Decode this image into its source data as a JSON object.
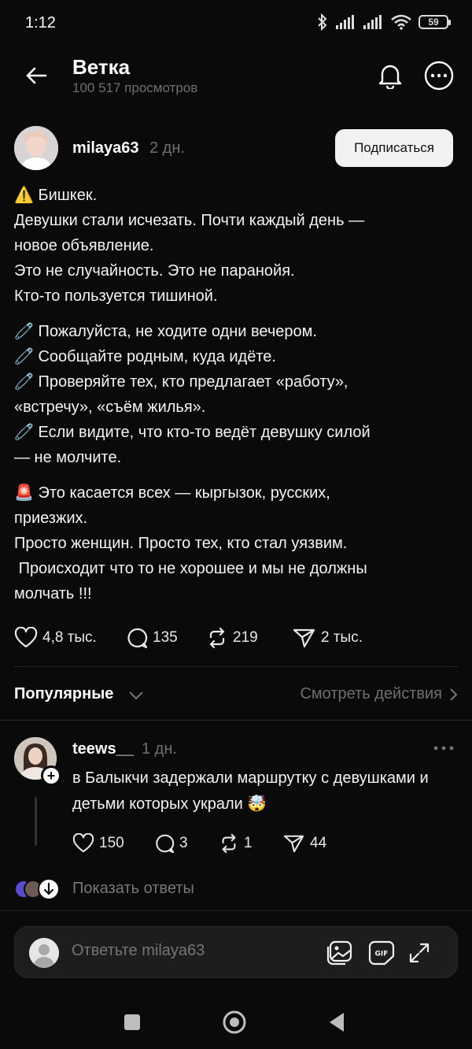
{
  "status_bar": {
    "time": "1:12",
    "battery": "59"
  },
  "header": {
    "title": "Ветка",
    "views": "100 517 просмотров"
  },
  "post": {
    "username": "milaya63",
    "time": "2 дн.",
    "subscribe_label": "Подписаться",
    "paragraphs": [
      [
        "⚠️ Бишкек.",
        "Девушки стали исчезать. Почти каждый день —",
        "новое объявление.",
        "Это не случайность. Это не паранойя.",
        "Кто-то пользуется тишиной."
      ],
      [
        "🧷 Пожалуйста, не ходите одни вечером.",
        "🧷 Сообщайте родным, куда идёте.",
        "🧷 Проверяйте тех, кто предлагает «работу»,",
        "«встречу», «съём жилья».",
        "🧷 Если видите, что кто-то ведёт девушку силой",
        "— не молчите."
      ],
      [
        "🚨 Это касается всех — кыргызок, русских,",
        "приезжих.",
        "Просто женщин. Просто тех, кто стал уязвим.",
        " Происходит что то не хорошее и мы не должны",
        "молчать !!!"
      ]
    ],
    "likes": "4,8 тыс.",
    "comments": "135",
    "reposts": "219",
    "shares": "2 тыс."
  },
  "sort": {
    "label": "Популярные",
    "view_actions": "Смотреть действия"
  },
  "comment": {
    "username": "teews__",
    "time": "1 дн.",
    "text": "в Балыкчи задержали маршрутку с девушками и детьми которых украли 🤯",
    "likes": "150",
    "comments": "3",
    "reposts": "1",
    "shares": "44"
  },
  "show_replies": "Показать ответы",
  "reply": {
    "placeholder": "Ответьте milaya63"
  },
  "colors": {
    "background": "#0a0a0a",
    "text": "#f3f3f3",
    "muted": "#6f6f6f",
    "button_bg": "#f2f2f2"
  },
  "icons": [
    "back-arrow-icon",
    "bell-icon",
    "more-icon",
    "heart-icon",
    "comment-icon",
    "repost-icon",
    "share-icon",
    "chevron-down-icon",
    "chevron-right-icon",
    "gallery-icon",
    "gif-icon",
    "expand-icon"
  ]
}
